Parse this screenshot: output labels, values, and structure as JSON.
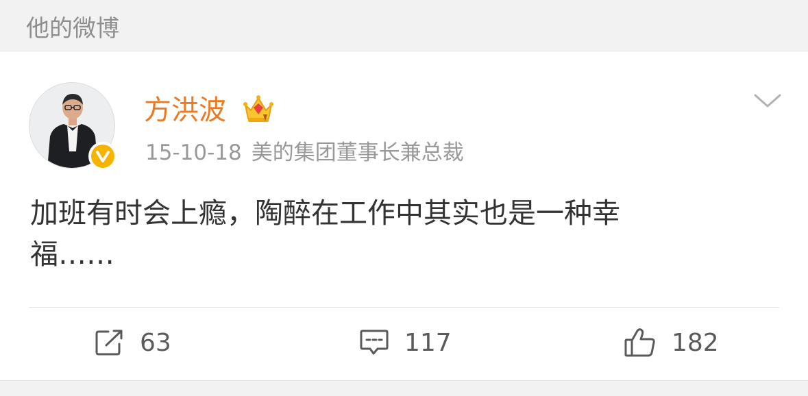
{
  "section": {
    "title": "他的微博"
  },
  "post": {
    "author": {
      "name": "方洪波"
    },
    "date": "15-10-18",
    "bio": "美的集团董事长兼总裁",
    "text_line1": "加班有时会上瘾，陶醉在工作中其实也是一种幸",
    "text_line2": "福……"
  },
  "actions": {
    "repost_count": "63",
    "comment_count": "117",
    "like_count": "182"
  },
  "colors": {
    "username": "#eb7a22",
    "verified_badge": "#f6b400",
    "meta_text": "#999999",
    "body_text": "#333333"
  },
  "icons": [
    "crown-icon",
    "verified-icon",
    "chevron-down-icon",
    "repost-icon",
    "comment-icon",
    "like-icon"
  ]
}
